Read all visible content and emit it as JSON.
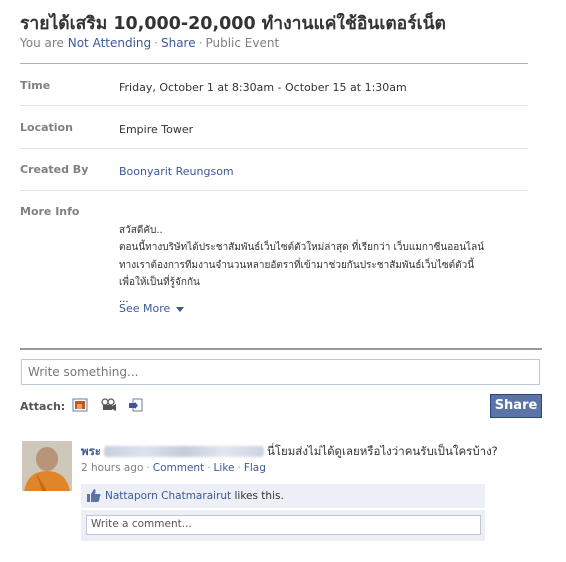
{
  "event": {
    "title": "รายได้เสริม 10,000-20,000 ทำงานแค่ใช้อินเตอร์เน็ต",
    "status_prefix": "You are",
    "status_value": "Not Attending",
    "share_link": "Share",
    "privacy": "Public Event"
  },
  "details": {
    "time_label": "Time",
    "time_value": "Friday, October 1 at 8:30am - October 15 at 1:30am",
    "location_label": "Location",
    "location_value": "Empire Tower",
    "created_label": "Created By",
    "created_value": "Boonyarit Reungsom",
    "info_label": "More Info",
    "info_lines": [
      "สวัสดีคับ..",
      "ตอนนี้ทางบริษัทได้ประชาสัมพันธ์เว็บไซต์ตัวใหม่ล่าสุด ที่เรียกว่า เว็บแมกาซีนออนไลน์",
      "ทางเราต้องการทีมงานจำนวนหลายอัตราที่เข้ามาช่วยกันประชาสัมพันธ์เว็บไซต์ตัวนี้",
      "เพื่อให้เป็นที่รู้จักกัน",
      "..."
    ],
    "see_more": "See More"
  },
  "composer": {
    "placeholder": "Write something...",
    "attach_label": "Attach:",
    "share_button": "Share",
    "attach_icons": [
      "photo-icon",
      "video-icon",
      "link-icon"
    ]
  },
  "post": {
    "author_initial": "พระ",
    "text": "นี่โยมส่งไม่ได้ดูเลยหรือไงว่าคนรับเป็นใครบ้าง?",
    "time": "2 hours ago",
    "comment_link": "Comment",
    "like_link": "Like",
    "flag_link": "Flag",
    "liker": "Nattaporn Chatmarairut",
    "likes_suffix": "likes this.",
    "comment_placeholder": "Write a comment..."
  },
  "colors": {
    "link": "#3b5998",
    "button": "#5b74a8",
    "comment_bg": "#eceff5"
  }
}
